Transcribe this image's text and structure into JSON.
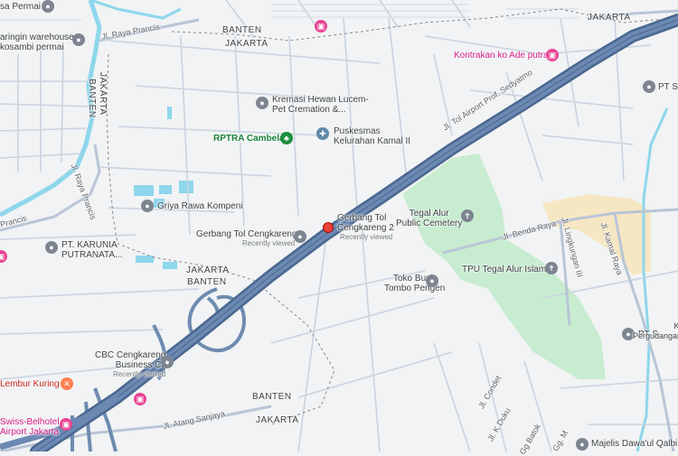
{
  "map": {
    "colors": {
      "background": "#f1f3f4",
      "road": "#b8c5d6",
      "highway": "#5b7ba3",
      "park": "#c8ecd0",
      "water": "#8ed6ec",
      "sand": "#f6e7c3",
      "border": "#888888"
    },
    "regions": {
      "banten_top": "BANTEN",
      "jakarta_top": "JAKARTA",
      "jakarta_mid": "JAKARTA",
      "banten_mid": "BANTEN",
      "banten_bottom": "BANTEN",
      "jakarta_bottom": "JAKARTA",
      "jakarta_right": "JAKARTA",
      "jakarta_vertical": "JAKARTA",
      "banten_vertical": "BANTEN"
    },
    "roads": {
      "raya_prancis_top": "Jl. Raya Prancis",
      "raya_prancis_left": "Jl. Raya Prancis",
      "prancis_cut": "Prancis",
      "tol_airport": "Jl. Tol Airport Prof. Sedyatmo",
      "benda_raya": "Jl. Benda Raya",
      "kamal_raya": "Jl. Kamal Raya",
      "lingkungan": "Jl. Lingkungan III",
      "atang_sanjaya": "Jl. Atang Sanjaya",
      "condet": "Jl. Condet",
      "k_duku": "Jl. K Duku",
      "gg_batok": "Gg Batok",
      "gg_m": "Gg. M"
    },
    "places": {
      "top_left_permai": "sa Permai",
      "warehouse": "aringin warehouse\nkosambi permai",
      "kremasi": "Kremasi Hewan Lucem-\nPet Cremation &...",
      "rptra": "RPTRA Cambela",
      "puskesmas": "Puskesmas\nKelurahan Kamal II",
      "kontrakan": "Kontrakan ko Ade putra",
      "pt_top_right": "PT S",
      "griya": "Griya Rawa Kompeni",
      "gerbang": "Gerbang Tol Cengkareng",
      "gerbang_sub": "Recently viewed",
      "gerbang2": "Gerbang Tol\nCengkareng 2",
      "gerbang2_sub": "Recently viewed",
      "tegal_alur_cemetery": "Tegal Alur\nPublic Cemetery",
      "tpu": "TPU Tegal Alur Islam",
      "toko_buah": "Toko Buah\nTombo Pengen",
      "pt_karunia": "PT. KARUNIA\nPUTRANATA...",
      "pt_right": "PT S",
      "cbc": "CBC Cengkareng\nBusiness Cit",
      "cbc_sub": "Recently viewed",
      "lembur": "Lembur Kuring",
      "swiss": "Swiss-Belhotel\nAirport Jakarta",
      "pergudangan": "Kom\nPergudangan M",
      "majelis": "Majelis Dawa'ul Qalbi"
    }
  }
}
